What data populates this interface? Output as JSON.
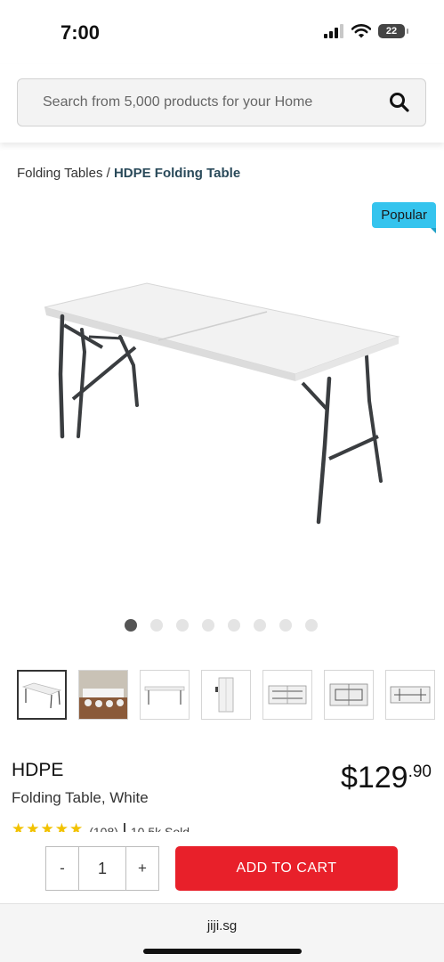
{
  "status": {
    "time": "7:00",
    "battery": "22"
  },
  "search": {
    "placeholder": "Search from 5,000 products for your Home"
  },
  "breadcrumb": {
    "parent": "Folding Tables",
    "separator": "/",
    "current": "HDPE Folding Table"
  },
  "badge": "Popular",
  "gallery": {
    "image_count": 8,
    "active_index": 0,
    "thumbnail_count": 7
  },
  "product": {
    "brand": "HDPE",
    "name": "Folding Table, White",
    "price_main": "$129",
    "price_cents": ".90",
    "stars": "★★★★★",
    "rating": 5,
    "review_count": "(108)",
    "sold": "10.5k Sold"
  },
  "cart": {
    "minus": "-",
    "quantity": "1",
    "plus": "+",
    "add_label": "ADD TO CART"
  },
  "browser": {
    "url": "jiji.sg"
  },
  "colors": {
    "accent": "#e8202a",
    "badge": "#35c4ee",
    "breadcrumb_current": "#2a4a5a"
  }
}
